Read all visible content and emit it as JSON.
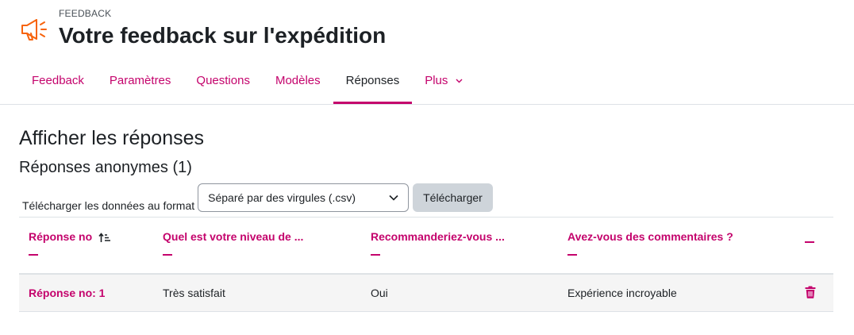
{
  "header": {
    "eyebrow": "FEEDBACK",
    "title": "Votre feedback sur l'expédition",
    "icon": "megaphone-icon",
    "icon_color": "#f7630c"
  },
  "tabs": [
    {
      "label": "Feedback",
      "active": false
    },
    {
      "label": "Paramètres",
      "active": false
    },
    {
      "label": "Questions",
      "active": false
    },
    {
      "label": "Modèles",
      "active": false
    },
    {
      "label": "Réponses",
      "active": true
    },
    {
      "label": "Plus",
      "active": false,
      "has_dropdown": true
    }
  ],
  "content": {
    "heading": "Afficher les réponses",
    "subheading": "Réponses anonymes (1)",
    "download_label": "Télécharger les données au format",
    "format_select_value": "Séparé par des virgules (.csv)",
    "download_button": "Télécharger"
  },
  "table": {
    "columns": [
      {
        "label": "Réponse no",
        "sortable_icon": "sort-ascending-icon"
      },
      {
        "label": "Quel est votre niveau de ..."
      },
      {
        "label": "Recommanderiez-vous ..."
      },
      {
        "label": "Avez-vous des commentaires ?"
      },
      {
        "label": ""
      }
    ],
    "rows": [
      {
        "response": "Réponse no: 1",
        "satisfaction": "Très satisfait",
        "recommend": "Oui",
        "comments": "Expérience incroyable",
        "action_icon": "trash-icon"
      }
    ]
  },
  "colors": {
    "accent": "#c4036c",
    "text": "#1d2125",
    "button_bg": "#ced4da",
    "row_bg": "#f5f5f5"
  }
}
